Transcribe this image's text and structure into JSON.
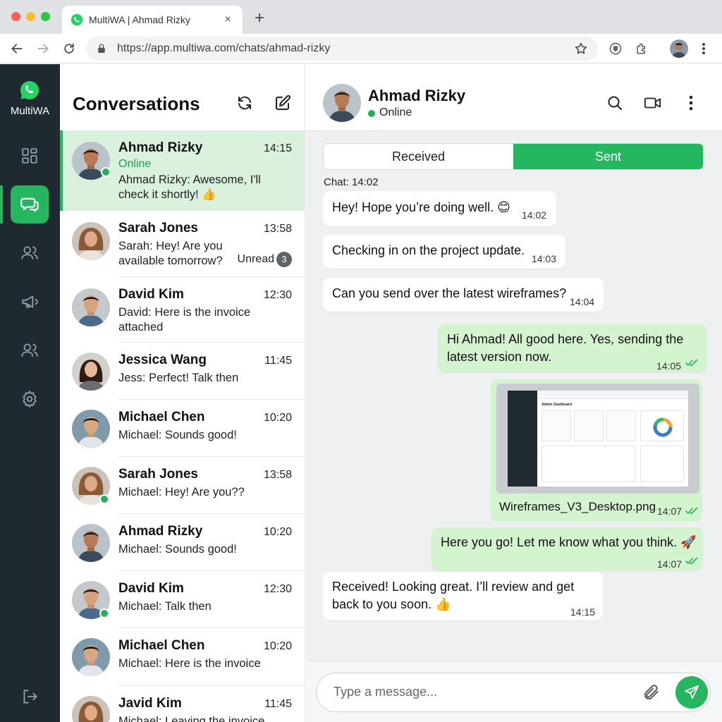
{
  "browser": {
    "tab_title": "MultiWA | Ahmad Rizky",
    "tab_close": "×",
    "new_tab": "+",
    "url": "https://app.multiwa.com/chats/ahmad-rizky"
  },
  "app": {
    "brand": "MultiWA",
    "accent_color": "#25b760",
    "rail_items": [
      "dashboard-icon",
      "chats-icon",
      "contacts-icon",
      "broadcast-icon",
      "groups-icon",
      "settings-icon"
    ],
    "active_rail": "chats-icon"
  },
  "conversations": {
    "title": "Conversations",
    "items": [
      {
        "name": "Ahmad Rizky",
        "time": "14:15",
        "status": "Online",
        "preview": [
          "Ahmad Rizky: Awesome, I'll",
          "check it shortly! 👍"
        ],
        "online": true,
        "active": true
      },
      {
        "name": "Sarah Jones",
        "time": "13:58",
        "preview": [
          "Sarah: Hey! Are you",
          "available tomorrow?"
        ],
        "unread_label": "Unread",
        "unread_count": "3"
      },
      {
        "name": "David Kim",
        "time": "12:30",
        "preview": [
          "David: Here is the invoice",
          "attached"
        ]
      },
      {
        "name": "Jessica Wang",
        "time": "11:45",
        "preview": [
          "Jess: Perfect! Talk then"
        ]
      },
      {
        "name": "Michael Chen",
        "time": "10:20",
        "preview": [
          "Michael: Sounds good!"
        ]
      },
      {
        "name": "Sarah Jones",
        "time": "13:58",
        "preview": [
          "Michael: Hey! Are you??"
        ],
        "online": true
      },
      {
        "name": "Ahmad Rizky",
        "time": "10:20",
        "preview": [
          "Michael: Sounds good!"
        ]
      },
      {
        "name": "David Kim",
        "time": "12:30",
        "preview": [
          "Michael: Talk then"
        ],
        "online": true
      },
      {
        "name": "Michael Chen",
        "time": "10:20",
        "preview": [
          "Michael: Here is the invoice"
        ]
      },
      {
        "name": "Javid Kim",
        "time": "11:45",
        "preview": [
          "Michael: Leaving the invoice"
        ]
      }
    ]
  },
  "chat": {
    "name": "Ahmad Rizky",
    "status": "Online",
    "tab_received": "Received",
    "tab_sent": "Sent",
    "label": "Chat: 14:02",
    "messages": [
      {
        "dir": "in",
        "lines": [
          "Hey! Hope you’re doing well. 😊"
        ],
        "time": "14:02"
      },
      {
        "dir": "in",
        "lines": [
          "Checking in on the project update."
        ],
        "time": "14:03"
      },
      {
        "dir": "in",
        "lines": [
          "Can you send over the latest wireframes?"
        ],
        "time": "14:04"
      },
      {
        "dir": "out",
        "lines": [
          "Hi Ahmad! All good here. Yes, sending the",
          "latest version now."
        ],
        "time": "14:05",
        "read": true
      },
      {
        "dir": "out",
        "type": "image",
        "caption": "Wireframes_V3_Desktop.png",
        "time": "14:07",
        "read": true,
        "preview_title": "Admin Dashboard"
      },
      {
        "dir": "out",
        "lines": [
          "Here you go! Let me know what you think. 🚀"
        ],
        "time": "14:07",
        "read": true
      },
      {
        "dir": "in",
        "lines": [
          "Received! Looking great. I’ll review and get",
          "back to you soon. 👍"
        ],
        "time": "14:15"
      }
    ],
    "composer_placeholder": "Type a message..."
  }
}
